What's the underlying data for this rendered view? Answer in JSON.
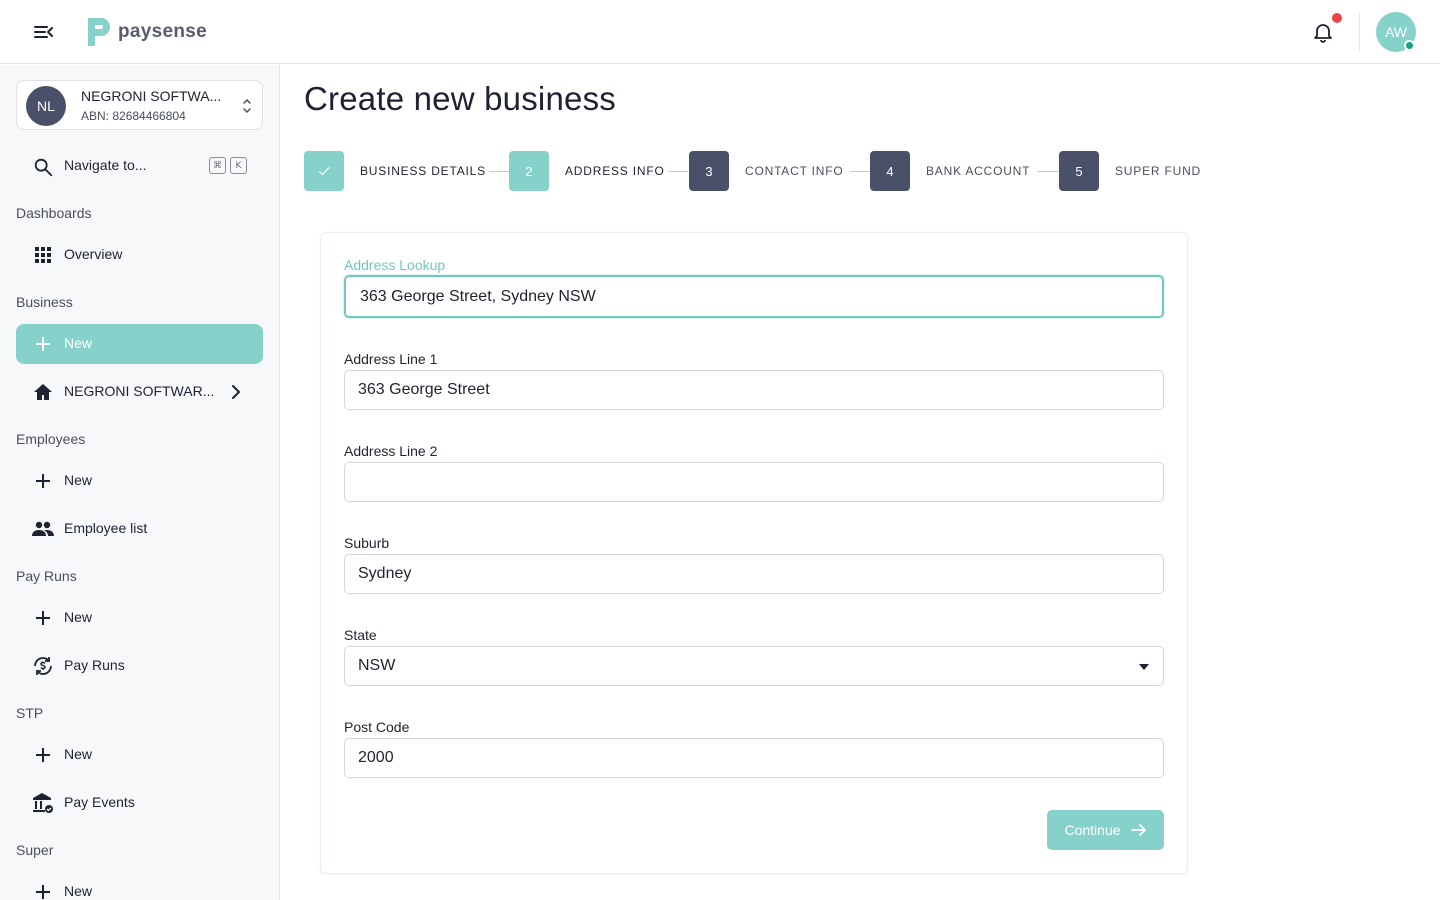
{
  "app": {
    "brand": "paysense",
    "user_initials": "AW",
    "accent_color": "#86d2cb",
    "dark_color": "#4a5068",
    "notification_dot_color": "#ef4444"
  },
  "sidebar": {
    "org": {
      "initials": "NL",
      "name": "NEGRONI SOFTWA...",
      "abn": "ABN: 82684466804"
    },
    "search": {
      "label": "Navigate to...",
      "shortcut_cmd": "⌘",
      "shortcut_key": "K"
    },
    "sections": {
      "dashboards": "Dashboards",
      "business": "Business",
      "employees": "Employees",
      "pay_runs": "Pay Runs",
      "stp": "STP",
      "super": "Super"
    },
    "items": {
      "overview": "Overview",
      "business_new": "New",
      "business_org": "NEGRONI SOFTWAR...",
      "employees_new": "New",
      "employee_list": "Employee list",
      "payruns_new": "New",
      "pay_runs": "Pay Runs",
      "stp_new": "New",
      "pay_events": "Pay Events",
      "super_new": "New"
    }
  },
  "main": {
    "title": "Create new business",
    "steps": [
      {
        "number": "",
        "label": "BUSINESS DETAILS",
        "state": "done"
      },
      {
        "number": "2",
        "label": "ADDRESS INFO",
        "state": "current"
      },
      {
        "number": "3",
        "label": "CONTACT INFO",
        "state": "todo"
      },
      {
        "number": "4",
        "label": "BANK ACCOUNT",
        "state": "todo"
      },
      {
        "number": "5",
        "label": "SUPER FUND",
        "state": "todo"
      }
    ],
    "form": {
      "lookup": {
        "label": "Address Lookup",
        "value": "363 George Street, Sydney NSW"
      },
      "line1": {
        "label": "Address Line 1",
        "value": "363 George Street"
      },
      "line2": {
        "label": "Address Line 2",
        "value": ""
      },
      "suburb": {
        "label": "Suburb",
        "value": "Sydney"
      },
      "state": {
        "label": "State",
        "value": "NSW"
      },
      "postcode": {
        "label": "Post Code",
        "value": "2000"
      },
      "continue_label": "Continue"
    }
  }
}
